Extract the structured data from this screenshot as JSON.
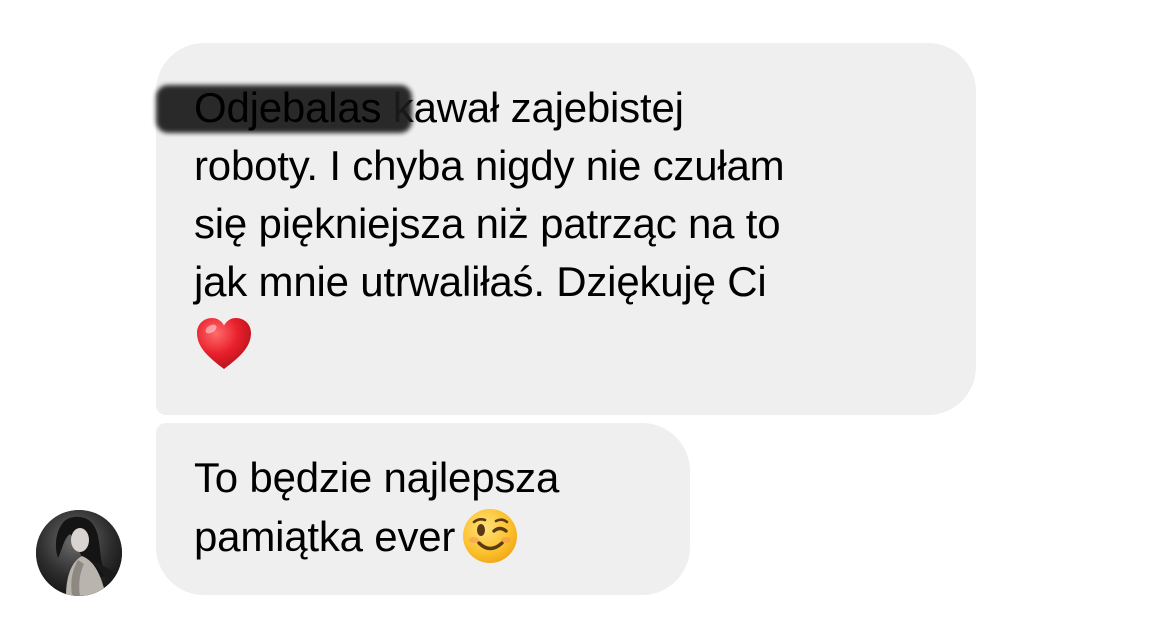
{
  "conversation": {
    "messages": [
      {
        "lines": [
          "Odjebalas",
          " kawał zajebistej",
          "roboty. I chyba nigdy nie czułam",
          "się piękniejsza niż patrząc na to",
          "jak mnie utrwaliłaś. Dziękuję Ci"
        ],
        "emoji": "red-heart-emoji"
      },
      {
        "lines": [
          "To będzie najlepsza",
          "pamiątka ever"
        ],
        "emoji": "winking-face-emoji"
      }
    ],
    "sender_avatar": "sender-avatar-photo"
  },
  "colors": {
    "bubble_background": "#efefef",
    "text": "#000000",
    "background": "#ffffff"
  }
}
